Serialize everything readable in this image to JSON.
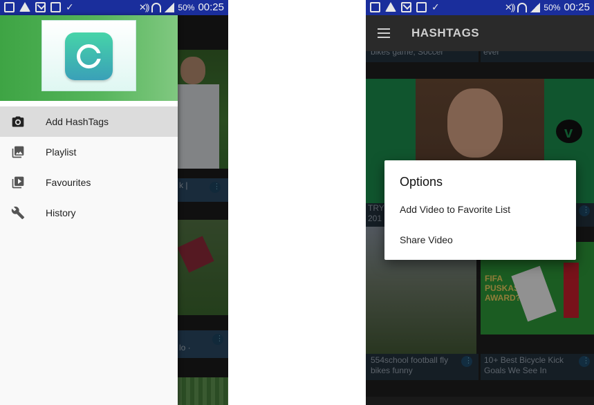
{
  "status_bar": {
    "battery": "50%",
    "time": "00:25"
  },
  "drawer": {
    "items": [
      {
        "label": "Add HashTags",
        "icon": "camera-icon",
        "active": true
      },
      {
        "label": "Playlist",
        "icon": "photo-library-icon",
        "active": false
      },
      {
        "label": "Favourites",
        "icon": "video-library-icon",
        "active": false
      },
      {
        "label": "History",
        "icon": "wrench-icon",
        "active": false
      }
    ]
  },
  "left_background": {
    "caption_1": "k |",
    "caption_2": "lo ·"
  },
  "app_bar": {
    "title": "HASHTAGS"
  },
  "right_background": {
    "top_left_caption": "bikes game, Soccer",
    "top_right_caption": "ever",
    "mid_left_caption": "TRY",
    "mid_left_caption_2": "201",
    "bottom_left_caption": "554school football fly bikes funny",
    "bottom_right_caption": "10+ Best Bicycle Kick Goals We See In",
    "thumbnail_overlay_text": "FIFA PUSKAS AWARD?"
  },
  "dialog": {
    "title": "Options",
    "items": [
      "Add Video to Favorite List",
      "Share Video"
    ]
  },
  "colors": {
    "status_bar": "#1a2e9c",
    "drawer_header": "#4caf50",
    "app_bar": "#2a2a2a",
    "active_item": "#dcdcdc"
  }
}
